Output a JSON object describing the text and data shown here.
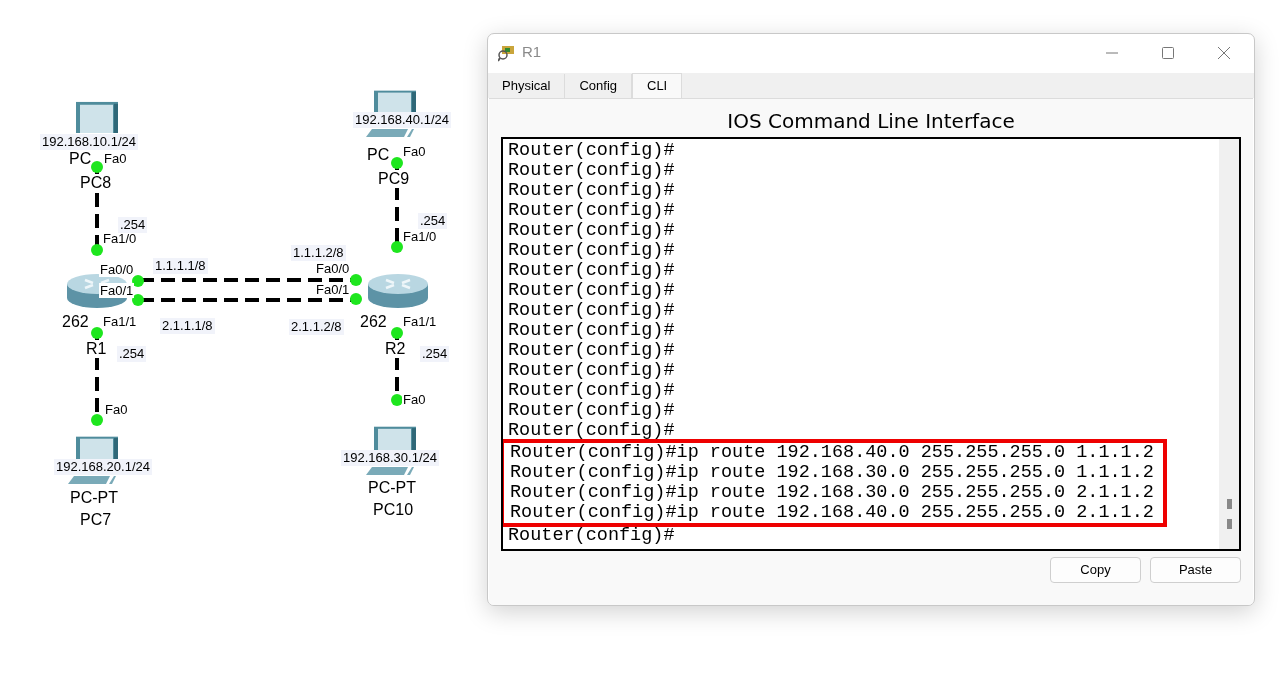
{
  "topology": {
    "pcs": [
      {
        "ip": "192.168.10.1/24",
        "type": "PC",
        "name": "PC8"
      },
      {
        "ip": "192.168.40.1/24",
        "type": "PC",
        "name": "PC9"
      },
      {
        "ip": "192.168.20.1/24",
        "type": "PC-PT",
        "name": "PC7"
      },
      {
        "ip": "192.168.30.1/24",
        "type": "PC-PT",
        "name": "PC10"
      }
    ],
    "routers": [
      {
        "model": "262",
        "name": "R1"
      },
      {
        "model": "262",
        "name": "R2"
      }
    ],
    "interface_labels": [
      "Fa0",
      "Fa1/0",
      "Fa0/0",
      "Fa0/1",
      "Fa1/1",
      "Fa0",
      "Fa0",
      "Fa1/0",
      "Fa0/0",
      "Fa0/1",
      "Fa1/1",
      "Fa0"
    ],
    "address_labels": [
      ".254",
      "1.1.1.1/8",
      "2.1.1.1/8",
      ".254",
      ".254",
      "1.1.1.2/8",
      "2.1.1.2/8",
      ".254"
    ]
  },
  "window": {
    "title": "R1",
    "tabs": [
      {
        "label": "Physical",
        "selected": false
      },
      {
        "label": "Config",
        "selected": false
      },
      {
        "label": "CLI",
        "selected": true
      }
    ],
    "heading": "IOS Command Line Interface",
    "terminal": {
      "lines": [
        "Router(config)#",
        "Router(config)#",
        "Router(config)#",
        "Router(config)#",
        "Router(config)#",
        "Router(config)#",
        "Router(config)#",
        "Router(config)#",
        "Router(config)#",
        "Router(config)#",
        "Router(config)#",
        "Router(config)#",
        "Router(config)#",
        "Router(config)#",
        "Router(config)#"
      ],
      "highlighted_lines": [
        "Router(config)#ip route 192.168.40.0 255.255.255.0 1.1.1.2",
        "Router(config)#ip route 192.168.30.0 255.255.255.0 1.1.1.2",
        "Router(config)#ip route 192.168.30.0 255.255.255.0 2.1.1.2",
        "Router(config)#ip route 192.168.40.0 255.255.255.0 2.1.1.2"
      ],
      "last_line": "Router(config)#"
    },
    "buttons": [
      "Copy",
      "Paste"
    ]
  }
}
